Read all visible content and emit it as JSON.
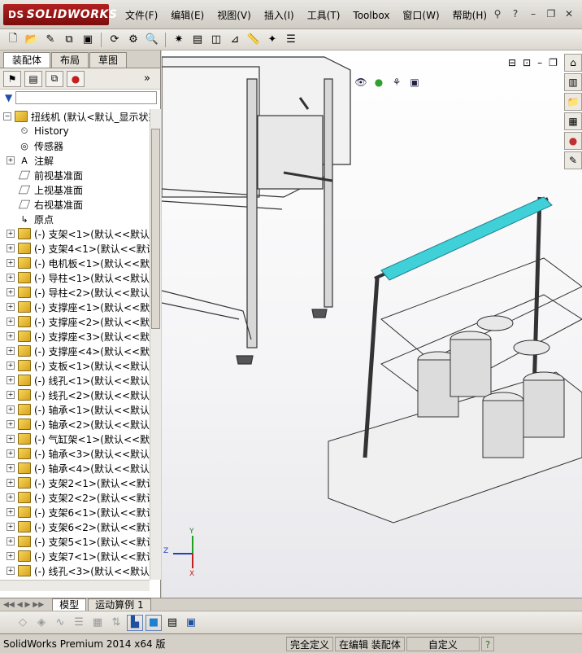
{
  "app": {
    "logo_text": "SOLIDWORKS",
    "logo_mark": "DS"
  },
  "menu": [
    "文件(F)",
    "编辑(E)",
    "视图(V)",
    "插入(I)",
    "工具(T)",
    "Toolbox",
    "窗口(W)",
    "帮助(H)"
  ],
  "panel_tabs": [
    "装配体",
    "布局",
    "草图"
  ],
  "tree": {
    "root": "扭线机  (默认<默认_显示状态",
    "fixed": [
      {
        "label": "History",
        "icon": "history-icon"
      },
      {
        "label": "传感器",
        "icon": "sensor-icon"
      },
      {
        "label": "注解",
        "icon": "annotation-icon",
        "expandable": true
      },
      {
        "label": "前视基准面",
        "icon": "plane-icon"
      },
      {
        "label": "上视基准面",
        "icon": "plane-icon"
      },
      {
        "label": "右视基准面",
        "icon": "plane-icon"
      },
      {
        "label": "原点",
        "icon": "origin-icon"
      }
    ],
    "components": [
      {
        "name": "(-) 支架<1>",
        "config": "(默认<<默认"
      },
      {
        "name": "(-) 支架4<1>",
        "config": "(默认<<默认"
      },
      {
        "name": "(-) 电机板<1>",
        "config": "(默认<<默"
      },
      {
        "name": "(-) 导柱<1>",
        "config": "(默认<<默认"
      },
      {
        "name": "(-) 导柱<2>",
        "config": "(默认<<默认"
      },
      {
        "name": "(-) 支撑座<1>",
        "config": "(默认<<默"
      },
      {
        "name": "(-) 支撑座<2>",
        "config": "(默认<<默"
      },
      {
        "name": "(-) 支撑座<3>",
        "config": "(默认<<默"
      },
      {
        "name": "(-) 支撑座<4>",
        "config": "(默认<<默"
      },
      {
        "name": "(-) 支板<1>",
        "config": "(默认<<默认"
      },
      {
        "name": "(-) 线孔<1>",
        "config": "(默认<<默认"
      },
      {
        "name": "(-) 线孔<2>",
        "config": "(默认<<默认"
      },
      {
        "name": "(-) 轴承<1>",
        "config": "(默认<<默认"
      },
      {
        "name": "(-) 轴承<2>",
        "config": "(默认<<默认"
      },
      {
        "name": "(-) 气缸架<1>",
        "config": "(默认<<默"
      },
      {
        "name": "(-) 轴承<3>",
        "config": "(默认<<默认"
      },
      {
        "name": "(-) 轴承<4>",
        "config": "(默认<<默认"
      },
      {
        "name": "(-) 支架2<1>",
        "config": "(默认<<默认"
      },
      {
        "name": "(-) 支架2<2>",
        "config": "(默认<<默认"
      },
      {
        "name": "(-) 支架6<1>",
        "config": "(默认<<默认"
      },
      {
        "name": "(-) 支架6<2>",
        "config": "(默认<<默认"
      },
      {
        "name": "(-) 支架5<1>",
        "config": "(默认<<默认"
      },
      {
        "name": "(-) 支架7<1>",
        "config": "(默认<<默认"
      },
      {
        "name": "(-) 线孔<3>",
        "config": "(默认<<默认"
      }
    ]
  },
  "bottom_tabs": [
    "模型",
    "运动算例 1"
  ],
  "status": {
    "version": "SolidWorks Premium 2014 x64 版",
    "defined": "完全定义",
    "editing": "在编辑 装配体",
    "custom": "自定义"
  },
  "triad": {
    "x": "X",
    "y": "Y",
    "z": "Z"
  },
  "colors": {
    "accent": "#b32020",
    "tree_text": "#000000",
    "viewport_top": "#ffffff"
  }
}
